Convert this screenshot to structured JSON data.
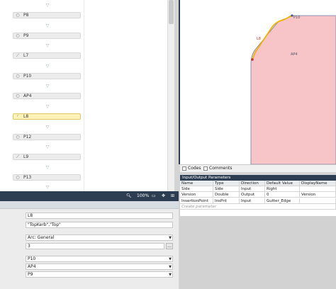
{
  "flow": {
    "items": [
      {
        "label": "P8",
        "icon": "circle-icon",
        "glyph": "○",
        "selected": false
      },
      {
        "label": "P9",
        "icon": "circle-icon",
        "glyph": "○",
        "selected": false
      },
      {
        "label": "L7",
        "icon": "line-icon",
        "glyph": "⟋",
        "selected": false
      },
      {
        "label": "P10",
        "icon": "circle-icon",
        "glyph": "○",
        "selected": false
      },
      {
        "label": "AP4",
        "icon": "circle-icon",
        "glyph": "○",
        "selected": false
      },
      {
        "label": "L8",
        "icon": "arc-icon",
        "glyph": "◜",
        "selected": true
      },
      {
        "label": "P12",
        "icon": "circle-icon",
        "glyph": "○",
        "selected": false
      },
      {
        "label": "L9",
        "icon": "line-icon",
        "glyph": "⟋",
        "selected": false
      },
      {
        "label": "P13",
        "icon": "circle-icon",
        "glyph": "○",
        "selected": false
      }
    ],
    "arrow_glyph": "▽"
  },
  "zoom": {
    "value": "100%"
  },
  "properties": {
    "name": "L8",
    "codes": "\"TopKerb\",\"Top\"",
    "type": "Arc: General",
    "number": "3",
    "start_point": "P10",
    "center_point": "AP4",
    "end_point": "P9"
  },
  "canvas": {
    "labels": [
      "P10",
      "L8",
      "AP4"
    ]
  },
  "bottom_tabs": {
    "codes": "Codes",
    "comments": "Comments"
  },
  "io_params": {
    "title": "Input/Output Parameters",
    "columns": [
      "Name",
      "Type",
      "Direction",
      "Default Value",
      "DisplayName"
    ],
    "rows": [
      [
        "Side",
        "Side",
        "Input",
        "Right",
        ""
      ],
      [
        "Version",
        "Double",
        "Output",
        "0",
        "Version"
      ],
      [
        "InsertionPoint",
        "InsPnt",
        "Input",
        "Gutter_Edge",
        ""
      ]
    ],
    "placeholder": "Create parameter"
  },
  "colors": {
    "dark_bar": "#2e3e52",
    "shape_fill": "#f7c5c8",
    "arc": "#f0b400",
    "selection": "#fdf2b8"
  }
}
